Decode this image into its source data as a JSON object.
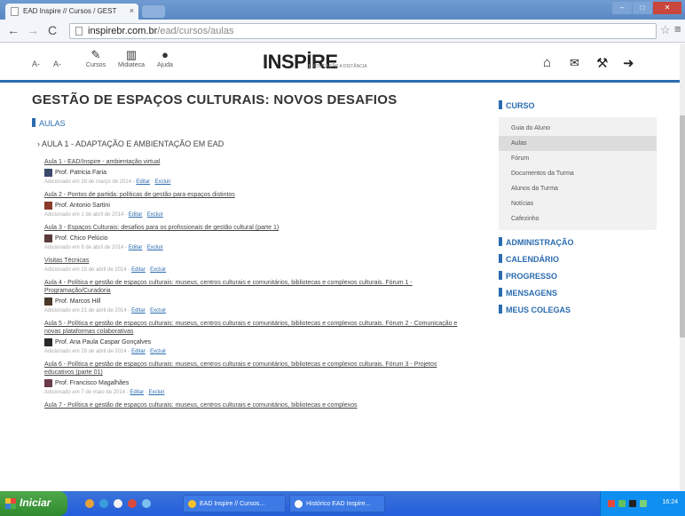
{
  "browser": {
    "tab_title": "EAD Inspire // Cursos / GEST",
    "tab_close": "×",
    "url_host": "inspirebr.com.br",
    "url_path": "/ead/cursos/aulas"
  },
  "header": {
    "font_decrease": "A-",
    "font_increase": "A-",
    "cursos_label": "Cursos",
    "midiateca_label": "Midiateca",
    "ajuda_label": "Ajuda",
    "logo": "INSPİRE",
    "logo_sub": "EDUCAÇÃO A DISTÂNCIA"
  },
  "page": {
    "title": "GESTÃO DE ESPAÇOS CULTURAIS: NOVOS DESAFIOS",
    "aulas_heading": "AULAS",
    "unit_title": "› AULA 1 - ADAPTAÇÃO E AMBIENTAÇÃO EM EAD"
  },
  "lessons": [
    {
      "title": "Aula 1 - EAD/Inspire - ambientação virtual",
      "prof": "Prof. Patricia Faria",
      "meta": "Adicionado em 28 de março de 2014 - ",
      "edit": "Editar",
      "delete": "Excluir"
    },
    {
      "title": "Aula 2 - Pontos de partida: políticas de gestão para espaços distintos",
      "prof": "Prof. Antonio Sartini",
      "meta": "Adicionado em 1 de abril de 2014 - ",
      "edit": "Editar",
      "delete": "Excluir"
    },
    {
      "title": "Aula 3 - Espaços Culturais: desafios para os profissionais de gestão cultural (parte 1)",
      "prof": "Prof. Chico Pelúcio",
      "meta": "Adicionado em 8 de abril de 2014 - ",
      "edit": "Editar",
      "delete": "Excluir"
    },
    {
      "title": "Visitas Técnicas",
      "prof": "",
      "meta": "Adicionado em 15 de abril de 2014 - ",
      "edit": "Editar",
      "delete": "Excluir"
    },
    {
      "title": "Aula 4 - Política e gestão de espaços culturais: museus, centros culturais e comunitários, bibliotecas e complexos culturais. Fórum 1 - Programação/Curadoria",
      "prof": "Prof. Marcos Hill",
      "meta": "Adicionado em 21 de abril de 2014 - ",
      "edit": "Editar",
      "delete": "Excluir"
    },
    {
      "title": "Aula 5 - Política e gestão de espaços culturais: museus, centros culturais e comunitários, bibliotecas e complexos culturais. Fórum 2 - Comunicação e novas plataformas colaborativas",
      "prof": "Prof. Ana Paula Caspar Gonçalves",
      "meta": "Adicionado em 28 de abril de 2014 - ",
      "edit": "Editar",
      "delete": "Excluir"
    },
    {
      "title": "Aula 6 - Política e gestão de espaços culturais: museus, centros culturais e comunitários, bibliotecas e complexos culturais. Fórum 3 - Projetos educativos (parte 01)",
      "prof": "Prof. Francisco Magalhães",
      "meta": "Adicionado em 7 de maio de 2014 - ",
      "edit": "Editar",
      "delete": "Excluir"
    },
    {
      "title": "Aula 7 - Política e gestão de espaços culturais: museus, centros culturais e comunitários, bibliotecas e complexos",
      "prof": "",
      "meta": "",
      "edit": "",
      "delete": ""
    }
  ],
  "sidebar": {
    "curso_heading": "CURSO",
    "curso_items": [
      "Guia do Aluno",
      "Aulas",
      "Fórum",
      "Documentos da Turma",
      "Alunos da Turma",
      "Notícias",
      "Cafezinho"
    ],
    "active_index": 1,
    "sections": [
      "ADMINISTRAÇÃO",
      "CALENDÁRIO",
      "PROGRESSO",
      "MENSAGENS",
      "MEUS COLEGAS"
    ]
  },
  "taskbar": {
    "start_label": "Iniciar",
    "task1": "EAD Inspire // Cursos...",
    "task2": "Histórico EAD Inspire...",
    "clock": "16:24"
  },
  "colors": {
    "accent": "#2b6cb0",
    "taskbar": "#245edb"
  }
}
